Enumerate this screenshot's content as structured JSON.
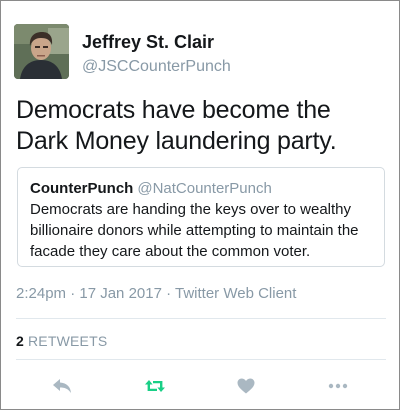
{
  "author": {
    "display_name": "Jeffrey St. Clair",
    "handle": "@JSCCounterPunch"
  },
  "tweet": {
    "text": "Democrats have become the Dark Money laundering party."
  },
  "quoted_tweet": {
    "display_name": "CounterPunch",
    "handle": "@NatCounterPunch",
    "text": "Democrats are handing the keys over to wealthy billionaire donors while attempting to maintain the facade they care about the common voter."
  },
  "metadata": {
    "time_date_source": "2:24pm · 17 Jan 2017 · Twitter Web Client"
  },
  "stats": {
    "retweet_count": "2",
    "retweet_label": "RETWEETS"
  },
  "actions": [
    {
      "name": "reply",
      "icon": "reply-icon"
    },
    {
      "name": "retweet",
      "icon": "retweet-icon"
    },
    {
      "name": "like",
      "icon": "heart-icon"
    },
    {
      "name": "more",
      "icon": "more-icon"
    }
  ],
  "colors": {
    "text_primary": "#14171a",
    "text_secondary": "#8899a6",
    "retweet_green": "#19cf86",
    "icon_gray": "#aab8c2",
    "border": "#d4dbe0"
  }
}
